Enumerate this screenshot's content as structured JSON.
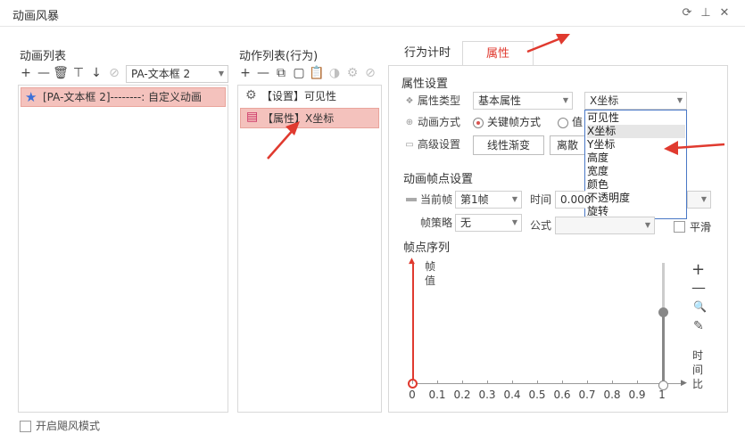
{
  "window": {
    "title": "动画风暴"
  },
  "animation_list": {
    "heading": "动画列表",
    "target_combo": "PA-文本框 2",
    "items": [
      {
        "text": "[PA-文本框 2]--------: 自定义动画"
      }
    ]
  },
  "action_list": {
    "heading": "动作列表(行为)",
    "items": [
      {
        "text": "【设置】可见性"
      },
      {
        "text": "【属性】X坐标"
      }
    ]
  },
  "tabs": {
    "timer": "行为计时",
    "properties": "属性"
  },
  "props": {
    "heading": "属性设置",
    "type_label": "属性类型",
    "type_value": "基本属性",
    "prop_value": "X坐标",
    "anim_mode_label": "动画方式",
    "keyframe_option": "关键帧方式",
    "value_option": "值",
    "advanced_label": "高级设置",
    "linear_button": "线性渐变",
    "discrete_button": "离散"
  },
  "dropdown": {
    "options": [
      "可见性",
      "X坐标",
      "Y坐标",
      "高度",
      "宽度",
      "颜色",
      "不透明度",
      "旋转"
    ],
    "selected_index": 1
  },
  "keyframes": {
    "heading": "动画帧点设置",
    "current_label": "当前帧",
    "current_value": "第1帧",
    "time_label": "时间",
    "time_value": "0.000",
    "strategy_label": "帧策略",
    "strategy_value": "无",
    "formula_label": "公式",
    "smooth_label": "平滑"
  },
  "sequence": {
    "heading": "帧点序列",
    "y_label_1": "帧",
    "y_label_2": "值",
    "x_ticks": [
      "0",
      "0.1",
      "0.2",
      "0.3",
      "0.4",
      "0.5",
      "0.6",
      "0.7",
      "0.8",
      "0.9",
      "1"
    ],
    "side_label": [
      "时",
      "间",
      "比"
    ],
    "slider_level": 0.6
  },
  "footer": {
    "gale_mode_label": "开启飓风模式"
  },
  "colors": {
    "accent_red": "#e03a2f",
    "selection": "#f4c2bd",
    "tab_red": "#e03a2f",
    "dropdown_border": "#4a78c6"
  }
}
